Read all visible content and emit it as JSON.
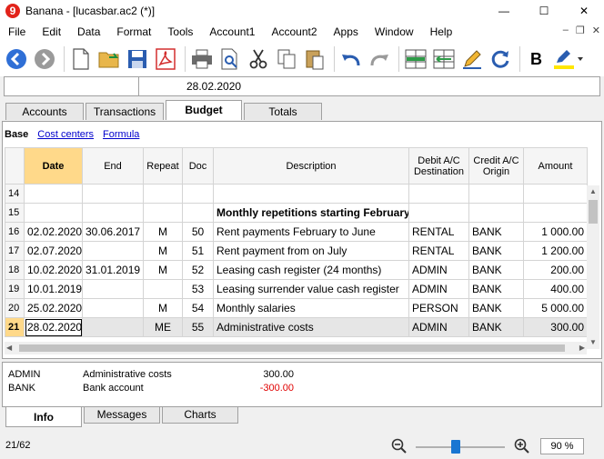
{
  "window": {
    "title": "Banana - [lucasbar.ac2 (*)]",
    "logo_glyph": "9",
    "minimize_glyph": "—",
    "maximize_glyph": "☐",
    "close_glyph": "✕"
  },
  "menu": [
    "File",
    "Edit",
    "Data",
    "Format",
    "Tools",
    "Account1",
    "Account2",
    "Apps",
    "Window",
    "Help"
  ],
  "mdi": {
    "minimize": "–",
    "restore": "❐",
    "close": "✕"
  },
  "toolbar": {
    "icons": [
      "back-icon",
      "forward-icon",
      "new-file-icon",
      "open-folder-icon",
      "save-icon",
      "pdf-icon",
      "print-icon",
      "print-preview-icon",
      "cut-icon",
      "copy-icon",
      "paste-icon",
      "undo-icon",
      "redo-icon",
      "add-row-icon",
      "delete-row-icon",
      "pencil-icon",
      "refresh-icon",
      "bold-icon",
      "highlight-icon"
    ],
    "bold_glyph": "B"
  },
  "address_bar": {
    "value": "28.02.2020"
  },
  "tabs": [
    {
      "label": "Accounts",
      "active": false
    },
    {
      "label": "Transactions",
      "active": false
    },
    {
      "label": "Budget",
      "active": true
    },
    {
      "label": "Totals",
      "active": false
    }
  ],
  "views": {
    "active": "Base",
    "links": [
      "Cost centers",
      "Formula"
    ]
  },
  "grid": {
    "columns": [
      "Date",
      "End",
      "Repeat",
      "Doc",
      "Description",
      "Debit A/C Destination",
      "Credit A/C Origin",
      "Amount"
    ],
    "rows": [
      {
        "rn": "14",
        "date": "",
        "end": "",
        "repeat": "",
        "doc": "",
        "desc": "",
        "debit": "",
        "credit": "",
        "amount": "",
        "bold": false
      },
      {
        "rn": "15",
        "date": "",
        "end": "",
        "repeat": "",
        "doc": "",
        "desc": "Monthly repetitions starting February",
        "debit": "",
        "credit": "",
        "amount": "",
        "bold": true
      },
      {
        "rn": "16",
        "date": "02.02.2020",
        "end": "30.06.2017",
        "repeat": "M",
        "doc": "50",
        "desc": "Rent payments February to June",
        "debit": "RENTAL",
        "credit": "BANK",
        "amount": "1 000.00",
        "bold": false
      },
      {
        "rn": "17",
        "date": "02.07.2020",
        "end": "",
        "repeat": "M",
        "doc": "51",
        "desc": "Rent payment from on July",
        "debit": "RENTAL",
        "credit": "BANK",
        "amount": "1 200.00",
        "bold": false
      },
      {
        "rn": "18",
        "date": "10.02.2020",
        "end": "31.01.2019",
        "repeat": "M",
        "doc": "52",
        "desc": "Leasing cash register (24 months)",
        "debit": "ADMIN",
        "credit": "BANK",
        "amount": "200.00",
        "bold": false
      },
      {
        "rn": "19",
        "date": "10.01.2019",
        "end": "",
        "repeat": "",
        "doc": "53",
        "desc": "Leasing surrender value cash register",
        "debit": "ADMIN",
        "credit": "BANK",
        "amount": "400.00",
        "bold": false
      },
      {
        "rn": "20",
        "date": "25.02.2020",
        "end": "",
        "repeat": "M",
        "doc": "54",
        "desc": "Monthly salaries",
        "debit": "PERSON",
        "credit": "BANK",
        "amount": "5 000.00",
        "bold": false
      },
      {
        "rn": "21",
        "date": "28.02.2020",
        "end": "",
        "repeat": "ME",
        "doc": "55",
        "desc": "Administrative costs",
        "debit": "ADMIN",
        "credit": "BANK",
        "amount": "300.00",
        "bold": false
      }
    ]
  },
  "info": [
    {
      "account": "ADMIN",
      "description": "Administrative costs",
      "amount": "300.00",
      "negative": false
    },
    {
      "account": "BANK",
      "description": "Bank account",
      "amount": "-300.00",
      "negative": true
    }
  ],
  "bottom_tabs": [
    {
      "label": "Info",
      "active": true
    },
    {
      "label": "Messages",
      "active": false
    },
    {
      "label": "Charts",
      "active": false
    }
  ],
  "status": {
    "row_count": "21/62",
    "zoom": "90  %",
    "zoom_level_percent": 90
  },
  "colors": {
    "active_header": "#ffd98a",
    "negative": "#e00000",
    "link": "#0000cc",
    "zoom_accent": "#1976d2"
  }
}
